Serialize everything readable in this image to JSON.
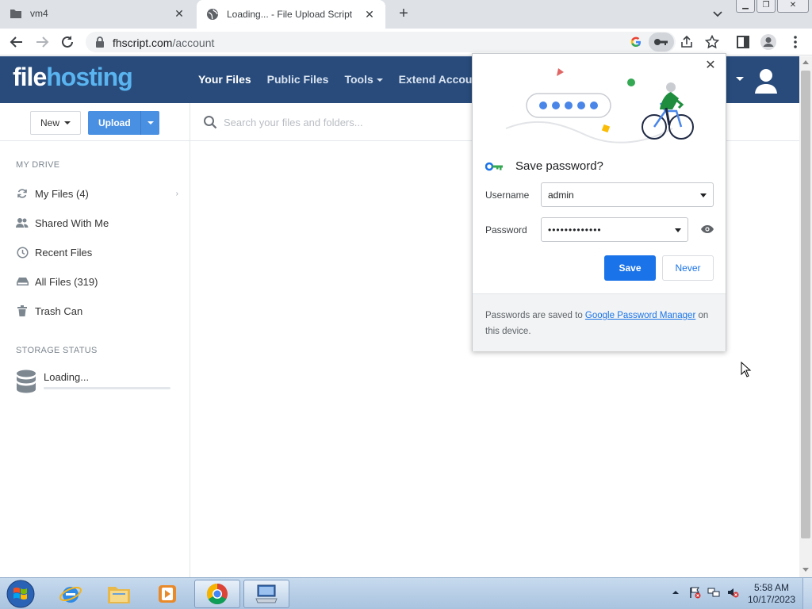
{
  "browser": {
    "tabs": [
      {
        "title": "vm4",
        "icon": "folder-icon"
      },
      {
        "title": "Loading... - File Upload Script",
        "icon": "globe-icon"
      }
    ],
    "url_host": "fhscript.com",
    "url_path": "/account"
  },
  "site": {
    "logo_part1": "file",
    "logo_part2": "hosting",
    "nav": [
      "Your Files",
      "Public Files",
      "Tools",
      "Extend Accoun"
    ],
    "new_label": "New",
    "upload_label": "Upload",
    "search_placeholder": "Search your files and folders..."
  },
  "sidebar": {
    "my_drive_title": "MY DRIVE",
    "items": [
      {
        "label": "My Files (4)",
        "icon": "refresh-icon"
      },
      {
        "label": "Shared With Me",
        "icon": "users-icon"
      },
      {
        "label": "Recent Files",
        "icon": "clock-icon"
      },
      {
        "label": "All Files (319)",
        "icon": "drive-icon"
      },
      {
        "label": "Trash Can",
        "icon": "trash-icon"
      }
    ],
    "storage_title": "STORAGE STATUS",
    "storage_text": "Loading..."
  },
  "password_dialog": {
    "title": "Save password?",
    "username_label": "Username",
    "username_value": "admin",
    "password_label": "Password",
    "password_value": "•••••••••••••",
    "save_label": "Save",
    "never_label": "Never",
    "footer_text_1": "Passwords are saved to ",
    "footer_link": "Google Password Manager",
    "footer_text_2": " on this device."
  },
  "taskbar": {
    "time": "5:58 AM",
    "date": "10/17/2023"
  },
  "colors": {
    "header_bg": "#284b7b",
    "upload_button": "#4a90e2",
    "save_button": "#1a73e8"
  }
}
